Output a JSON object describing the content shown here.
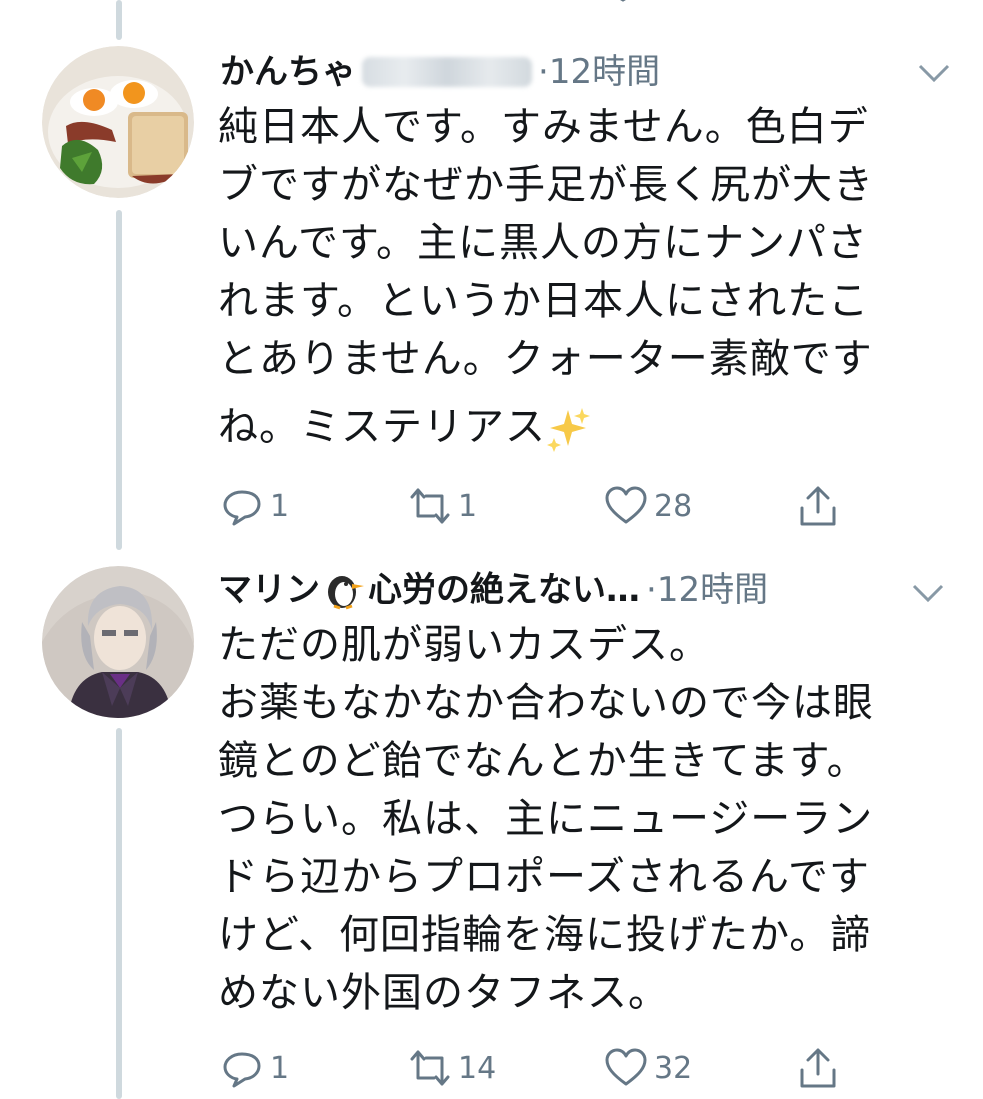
{
  "tweets": [
    {
      "name": "かんちゃ",
      "separator": "·",
      "time": "12時間",
      "lines": [
        "純日本人です。すみません。色白デ",
        "ブですがなぜか手足が長く尻が大き",
        "いんです。主に黒人の方にナンパさ",
        "れます。というか日本人にされたこ",
        "とありません。クォーター素敵です",
        "ね。ミステリアス"
      ],
      "trailing_emoji": "sparkles",
      "counts": {
        "reply": "1",
        "retweet": "1",
        "like": "28"
      }
    },
    {
      "name": "マリン",
      "name_rest": "心労の絶えない…",
      "separator": "·",
      "time": "12時間",
      "lines": [
        "ただの肌が弱いカスデス。",
        "お薬もなかなか合わないので今は眼",
        "鏡とのど飴でなんとか生きてます。",
        "つらい。私は、主にニュージーラン",
        "ドら辺からプロポーズされるんです",
        "けど、何回指輪を海に投げたか。諦",
        "めない外国のタフネス。"
      ],
      "counts": {
        "reply": "1",
        "retweet": "14",
        "like": "32"
      }
    }
  ],
  "icons": [
    "reply-icon",
    "retweet-icon",
    "like-icon",
    "share-icon",
    "caret-down-icon",
    "penguin-emoji",
    "sparkles-emoji"
  ],
  "colors": {
    "text": "#14171a",
    "secondary": "#657786",
    "thread": "#cfd9de"
  }
}
